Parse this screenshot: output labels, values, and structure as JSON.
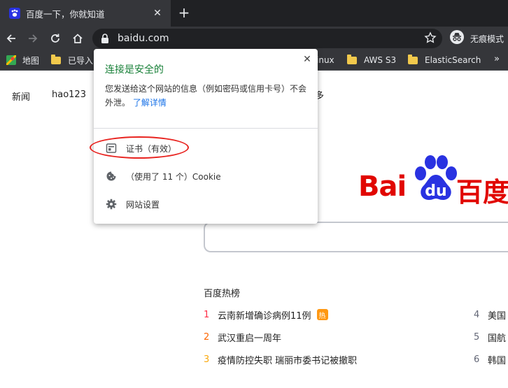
{
  "browser": {
    "tab_title": "百度一下，你就知道",
    "url": "baidu.com",
    "incognito_label": "无痕模式",
    "bookmarks": [
      {
        "label": "地图"
      },
      {
        "label": "已导入"
      },
      {
        "label": "inux"
      },
      {
        "label": "AWS S3"
      },
      {
        "label": "ElasticSearch"
      }
    ],
    "more_bookmarks": "»",
    "new_tab": "+",
    "tab_close": "✕"
  },
  "popup": {
    "title": "连接是安全的",
    "description": "您发送给这个网站的信息（例如密码或信用卡号）不会外泄。",
    "learn_more": "了解详情",
    "close": "✕",
    "items": [
      {
        "label": "证书（有效）"
      },
      {
        "label": "（使用了 11 个）Cookie"
      },
      {
        "label": "网站设置"
      }
    ],
    "highlight_color": "#e8231f",
    "secure_color": "#188038"
  },
  "page": {
    "top_links": [
      "新闻",
      "hao123"
    ],
    "stray_text": "多",
    "logo_latin": "Bai",
    "logo_du": "du",
    "logo_cn": "百度",
    "hot_title": "百度热榜",
    "hot_left": [
      {
        "rank": "1",
        "text": "云南新增确诊病例11例",
        "badge": "热",
        "color": "#fe2d46"
      },
      {
        "rank": "2",
        "text": "武汉重启一周年",
        "badge": "",
        "color": "#f60"
      },
      {
        "rank": "3",
        "text": "疫情防控失职 瑞丽市委书记被撤职",
        "badge": "",
        "color": "#faa90e"
      }
    ],
    "hot_right": [
      {
        "rank": "4",
        "text": "美国"
      },
      {
        "rank": "5",
        "text": "国航"
      },
      {
        "rank": "6",
        "text": "韩国"
      }
    ]
  }
}
